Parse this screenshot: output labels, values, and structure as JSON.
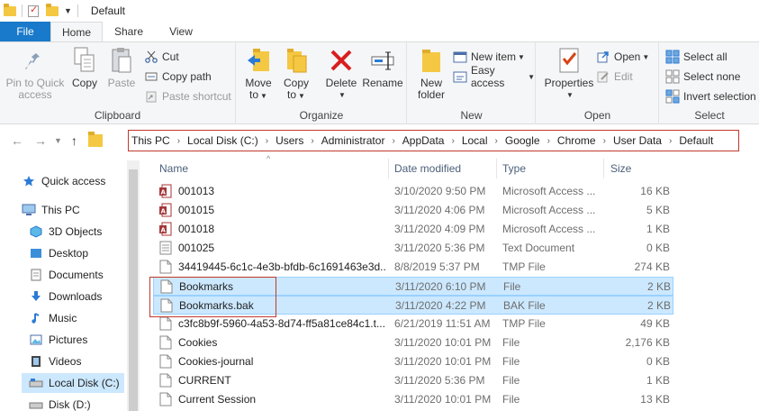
{
  "window": {
    "title": "Default"
  },
  "tabs": [
    "File",
    "Home",
    "Share",
    "View"
  ],
  "ribbon": {
    "clipboard": {
      "label": "Clipboard",
      "pin": "Pin to Quick access",
      "pin_l1": "Pin to Quick",
      "pin_l2": "access",
      "copy": "Copy",
      "paste": "Paste",
      "cut": "Cut",
      "copy_path": "Copy path",
      "paste_shortcut": "Paste shortcut"
    },
    "organize": {
      "label": "Organize",
      "move_l1": "Move",
      "move_l2": "to",
      "copy_l1": "Copy",
      "copy_l2": "to",
      "delete": "Delete",
      "rename": "Rename"
    },
    "new": {
      "label": "New",
      "new_folder_l1": "New",
      "new_folder_l2": "folder",
      "new_item": "New item",
      "easy_access": "Easy access"
    },
    "open": {
      "label": "Open",
      "properties": "Properties",
      "open": "Open",
      "edit": "Edit"
    },
    "select": {
      "label": "Select",
      "select_all": "Select all",
      "select_none": "Select none",
      "invert": "Invert selection"
    }
  },
  "breadcrumbs": [
    "This PC",
    "Local Disk (C:)",
    "Users",
    "Administrator",
    "AppData",
    "Local",
    "Google",
    "Chrome",
    "User Data",
    "Default"
  ],
  "nav": [
    {
      "label": "Quick access",
      "icon": "star-icon"
    },
    {
      "label": "This PC",
      "icon": "pc-icon"
    },
    {
      "label": "3D Objects",
      "icon": "cube-icon"
    },
    {
      "label": "Desktop",
      "icon": "desktop-icon"
    },
    {
      "label": "Documents",
      "icon": "documents-icon"
    },
    {
      "label": "Downloads",
      "icon": "download-icon"
    },
    {
      "label": "Music",
      "icon": "music-icon"
    },
    {
      "label": "Pictures",
      "icon": "pictures-icon"
    },
    {
      "label": "Videos",
      "icon": "video-icon"
    },
    {
      "label": "Local Disk (C:)",
      "icon": "drive-icon"
    },
    {
      "label": "Disk (D:)",
      "icon": "drive-icon"
    }
  ],
  "columns": {
    "name": "Name",
    "date": "Date modified",
    "type": "Type",
    "size": "Size"
  },
  "files": [
    {
      "name": "001013",
      "date": "3/10/2020 9:50 PM",
      "type": "Microsoft Access ...",
      "size": "16 KB",
      "icon": "access-icon"
    },
    {
      "name": "001015",
      "date": "3/11/2020 4:06 PM",
      "type": "Microsoft Access ...",
      "size": "5 KB",
      "icon": "access-icon"
    },
    {
      "name": "001018",
      "date": "3/11/2020 4:09 PM",
      "type": "Microsoft Access ...",
      "size": "1 KB",
      "icon": "access-icon"
    },
    {
      "name": "001025",
      "date": "3/11/2020 5:36 PM",
      "type": "Text Document",
      "size": "0 KB",
      "icon": "text-file-icon"
    },
    {
      "name": "34419445-6c1c-4e3b-bfdb-6c1691463e3d...",
      "date": "8/8/2019 5:37 PM",
      "type": "TMP File",
      "size": "274 KB",
      "icon": "file-icon"
    },
    {
      "name": "Bookmarks",
      "date": "3/11/2020 6:10 PM",
      "type": "File",
      "size": "2 KB",
      "icon": "file-icon",
      "selected": true
    },
    {
      "name": "Bookmarks.bak",
      "date": "3/11/2020 4:22 PM",
      "type": "BAK File",
      "size": "2 KB",
      "icon": "file-icon",
      "selected": true
    },
    {
      "name": "c3fc8b9f-5960-4a53-8d74-ff5a81ce84c1.t...",
      "date": "6/21/2019 11:51 AM",
      "type": "TMP File",
      "size": "49 KB",
      "icon": "file-icon"
    },
    {
      "name": "Cookies",
      "date": "3/11/2020 10:01 PM",
      "type": "File",
      "size": "2,176 KB",
      "icon": "file-icon"
    },
    {
      "name": "Cookies-journal",
      "date": "3/11/2020 10:01 PM",
      "type": "File",
      "size": "0 KB",
      "icon": "file-icon"
    },
    {
      "name": "CURRENT",
      "date": "3/11/2020 5:36 PM",
      "type": "File",
      "size": "1 KB",
      "icon": "file-icon"
    },
    {
      "name": "Current Session",
      "date": "3/11/2020 10:01 PM",
      "type": "File",
      "size": "13 KB",
      "icon": "file-icon"
    }
  ]
}
